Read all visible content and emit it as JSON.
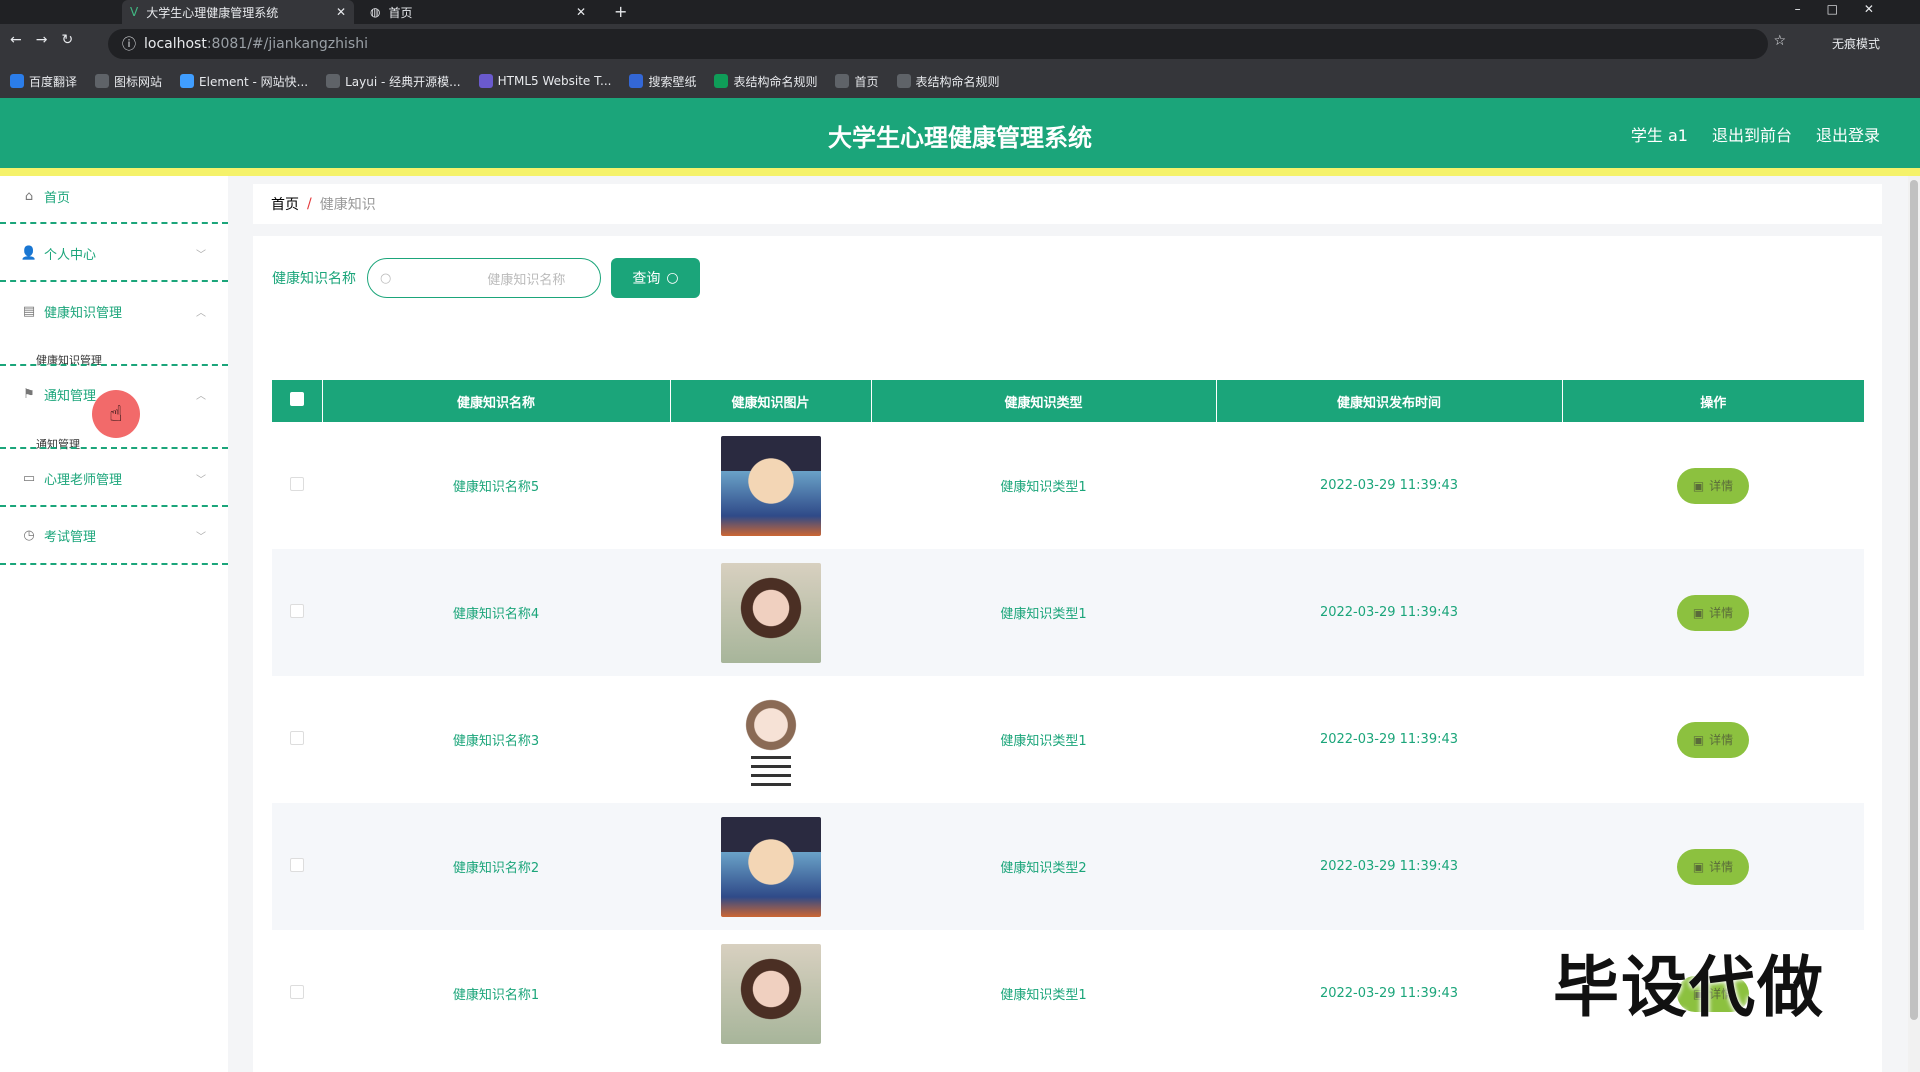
{
  "browser": {
    "tabs": [
      {
        "title": "大学生心理健康管理系统",
        "active": true
      },
      {
        "title": "首页",
        "active": false
      }
    ],
    "url_host": "localhost",
    "url_rest": ":8081/#/jiankangzhishi",
    "profile": "无痕模式",
    "bookmarks": [
      "百度翻译",
      "图标网站",
      "Element - 网站快...",
      "Layui - 经典开源模...",
      "HTML5 Website T...",
      "搜索壁纸",
      "表结构命名规则",
      "首页",
      "表结构命名规则"
    ]
  },
  "header": {
    "title": "大学生心理健康管理系统",
    "user": "学生 a1",
    "to_front": "退出到前台",
    "logout": "退出登录"
  },
  "sidebar": {
    "items": [
      {
        "label": "首页",
        "icon": "home-icon"
      },
      {
        "label": "个人中心",
        "icon": "user-icon"
      },
      {
        "label": "健康知识管理",
        "icon": "briefcase-icon",
        "sub": "健康知识管理"
      },
      {
        "label": "通知管理",
        "icon": "flag-icon",
        "sub": "通知管理"
      },
      {
        "label": "心理老师管理",
        "icon": "chat-icon"
      },
      {
        "label": "考试管理",
        "icon": "clock-icon"
      }
    ]
  },
  "breadcrumb": {
    "home": "首页",
    "sep": "/",
    "current": "健康知识"
  },
  "search": {
    "label": "健康知识名称",
    "placeholder": "健康知识名称",
    "button": "查询"
  },
  "table": {
    "columns": [
      "健康知识名称",
      "健康知识图片",
      "健康知识类型",
      "健康知识发布时间",
      "操作"
    ],
    "rows": [
      {
        "name": "健康知识名称5",
        "type": "健康知识类型1",
        "time": "2022-03-29 11:39:43",
        "img": "p0"
      },
      {
        "name": "健康知识名称4",
        "type": "健康知识类型1",
        "time": "2022-03-29 11:39:43",
        "img": "p1"
      },
      {
        "name": "健康知识名称3",
        "type": "健康知识类型1",
        "time": "2022-03-29 11:39:43",
        "img": "p2"
      },
      {
        "name": "健康知识名称2",
        "type": "健康知识类型2",
        "time": "2022-03-29 11:39:43",
        "img": "p0"
      },
      {
        "name": "健康知识名称1",
        "type": "健康知识类型1",
        "time": "2022-03-29 11:39:43",
        "img": "p1"
      }
    ],
    "detail_label": "详情"
  },
  "watermark": "毕设代做"
}
